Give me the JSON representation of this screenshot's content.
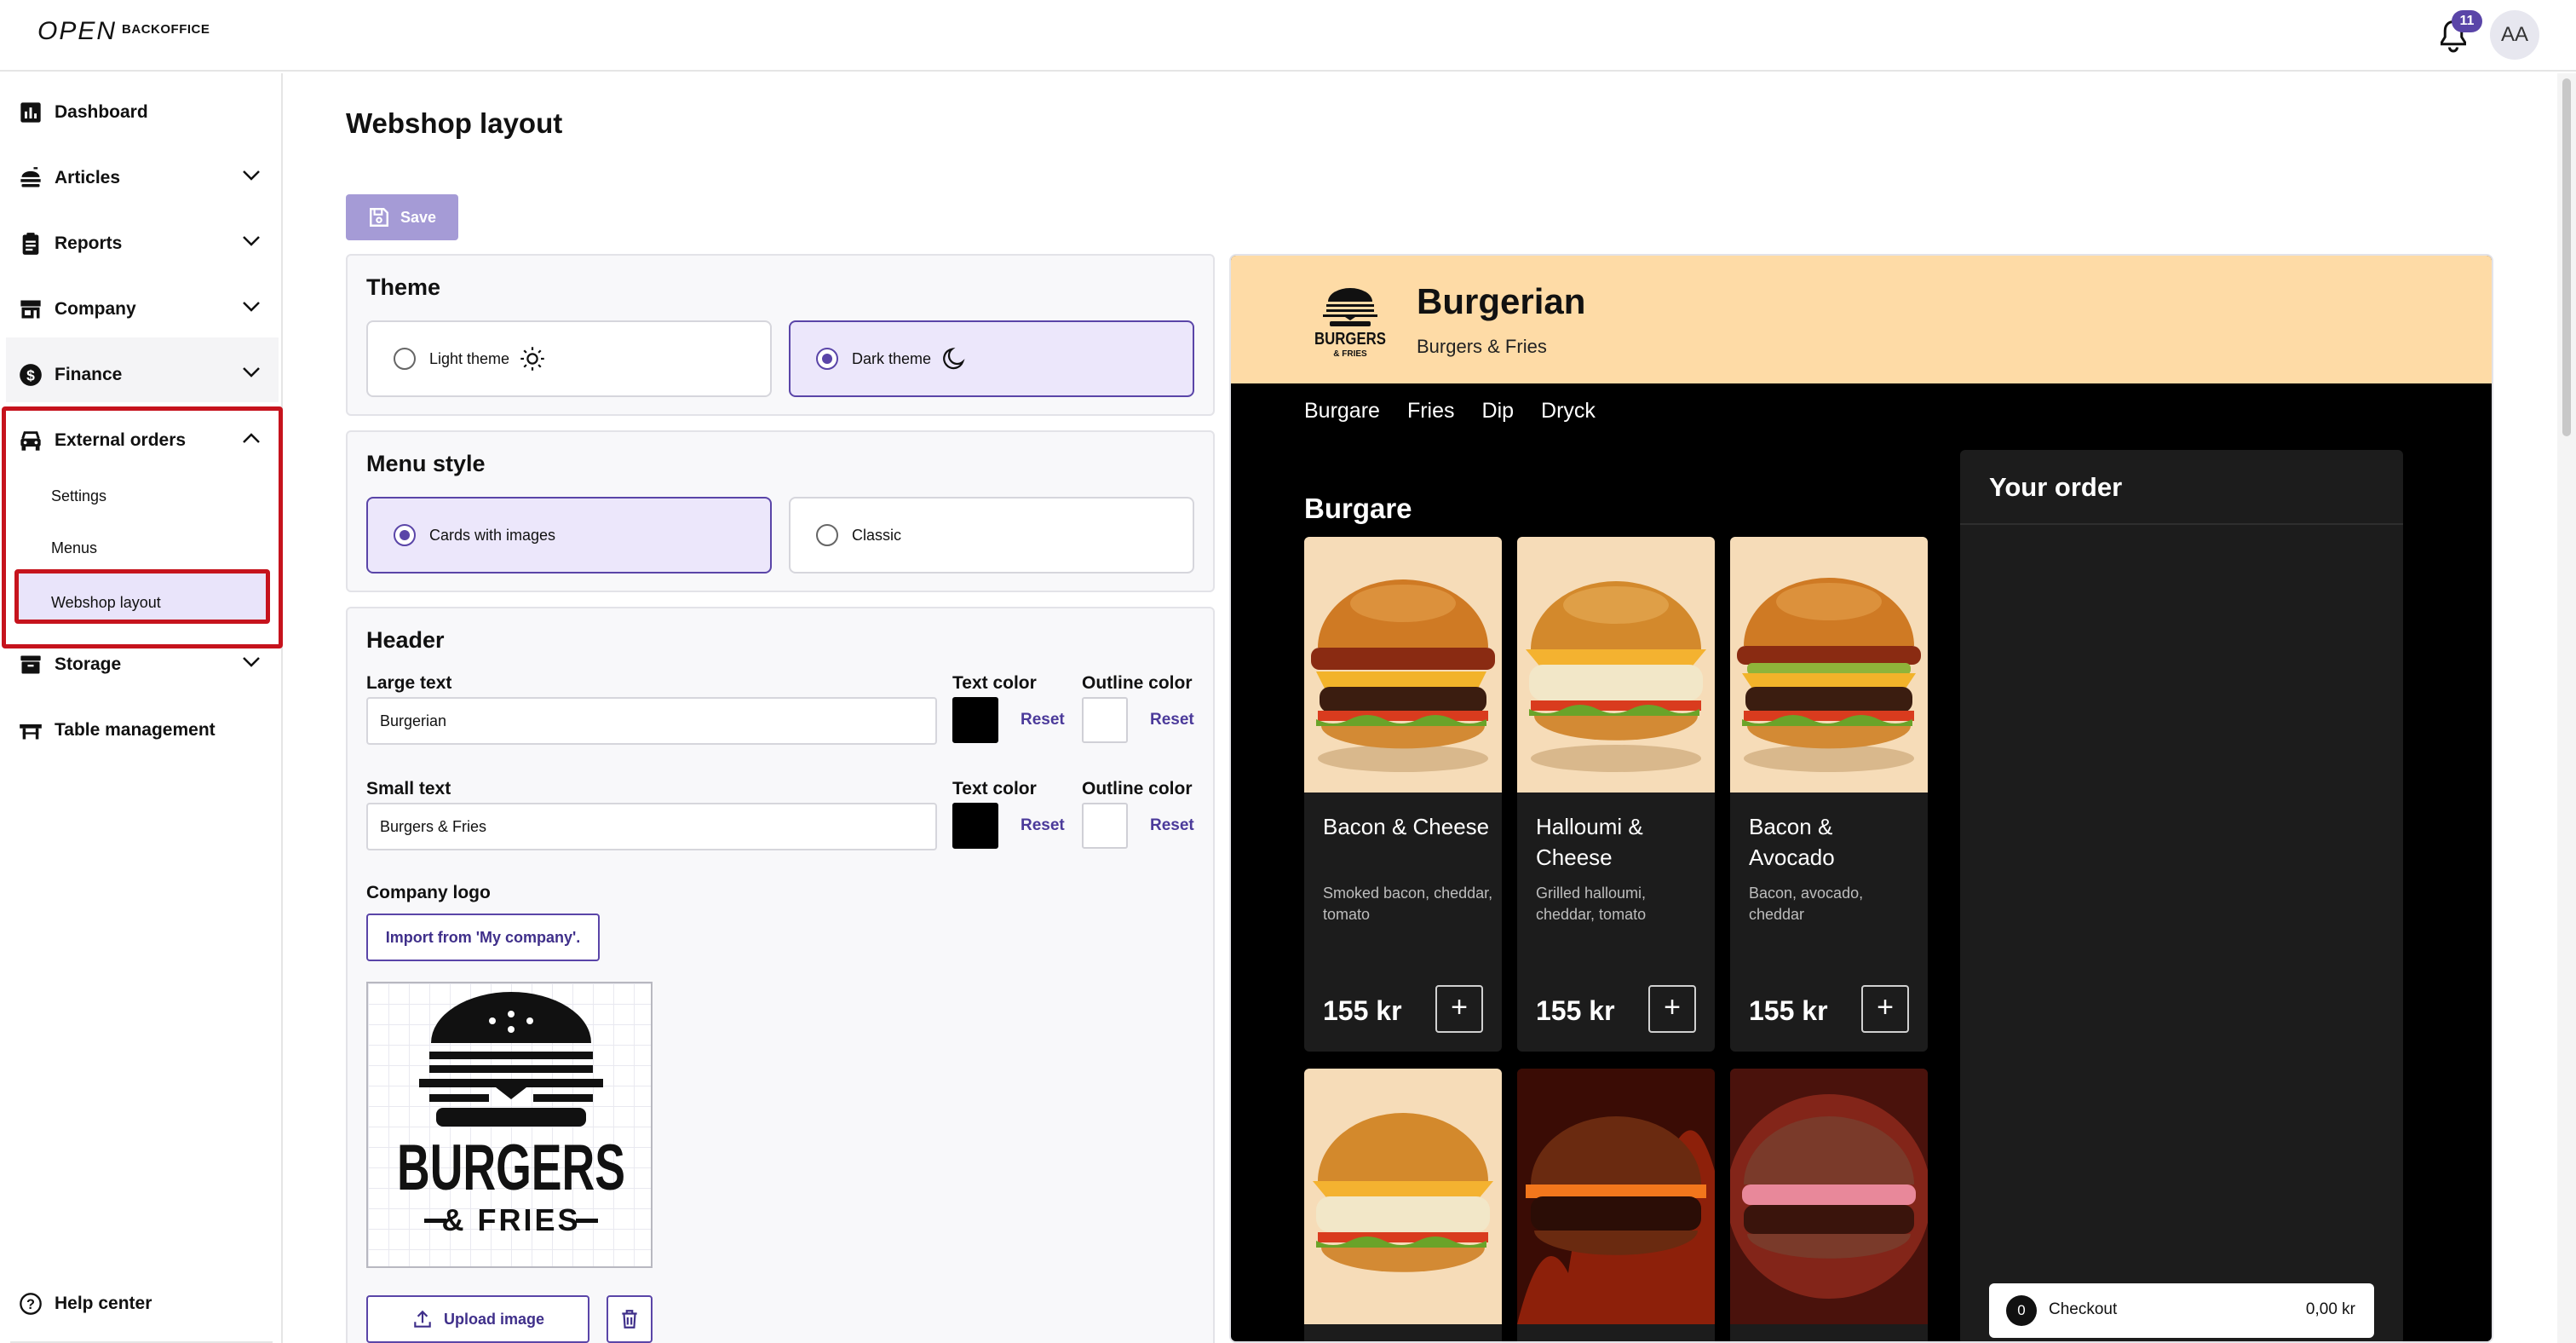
{
  "topbar": {
    "brand_primary": "OPEN",
    "brand_secondary": "BACKOFFICE",
    "notification_count": "11",
    "avatar_initials": "AA"
  },
  "sidebar": {
    "items": [
      {
        "label": "Dashboard",
        "icon": "bar-chart-icon"
      },
      {
        "label": "Articles",
        "icon": "burger-icon"
      },
      {
        "label": "Reports",
        "icon": "clipboard-icon"
      },
      {
        "label": "Company",
        "icon": "storefront-icon"
      },
      {
        "label": "Finance",
        "icon": "dollar-circle-icon"
      },
      {
        "label": "External orders",
        "icon": "car-icon"
      },
      {
        "label": "Storage",
        "icon": "archive-icon"
      },
      {
        "label": "Table management",
        "icon": "table-icon"
      }
    ],
    "external_orders_sub": [
      "Settings",
      "Menus",
      "Webshop layout"
    ],
    "help": "Help center"
  },
  "page": {
    "title": "Webshop layout",
    "save_label": "Save"
  },
  "theme": {
    "title": "Theme",
    "light_label": "Light theme",
    "dark_label": "Dark theme",
    "selected": "dark"
  },
  "menu_style": {
    "title": "Menu style",
    "cards_label": "Cards with images",
    "classic_label": "Classic",
    "selected": "cards"
  },
  "header": {
    "title": "Header",
    "large_text_label": "Large text",
    "large_text_value": "Burgerian",
    "small_text_label": "Small text",
    "small_text_value": "Burgers & Fries",
    "text_color_label": "Text color",
    "outline_color_label": "Outline color",
    "reset_label": "Reset",
    "text_color": "#000000",
    "outline_color": "#ffffff",
    "company_logo_label": "Company logo",
    "import_label": "Import from 'My company'.",
    "upload_label": "Upload image",
    "logo_text_main": "BURGERS",
    "logo_text_sub": "& FRIES"
  },
  "preview": {
    "header_bg": "#fedba6",
    "name": "Burgerian",
    "subtitle": "Burgers & Fries",
    "logo_text_main": "BURGERS",
    "logo_text_sub": "& FRIES",
    "nav": [
      "Burgare",
      "Fries",
      "Dip",
      "Dryck"
    ],
    "section": "Burgare",
    "products": [
      {
        "title": "Bacon & Cheese",
        "desc": "Smoked bacon, cheddar, tomato",
        "price": "155 kr",
        "style": "bacon"
      },
      {
        "title": "Halloumi & Cheese",
        "desc": "Grilled halloumi, cheddar, tomato",
        "price": "155 kr",
        "style": "halloumi"
      },
      {
        "title": "Bacon & Avocado",
        "desc": "Bacon, avocado, cheddar",
        "price": "155 kr",
        "style": "avocado"
      }
    ],
    "order_title": "Your order",
    "checkout_count": "0",
    "checkout_label": "Checkout",
    "checkout_total": "0,00 kr"
  }
}
